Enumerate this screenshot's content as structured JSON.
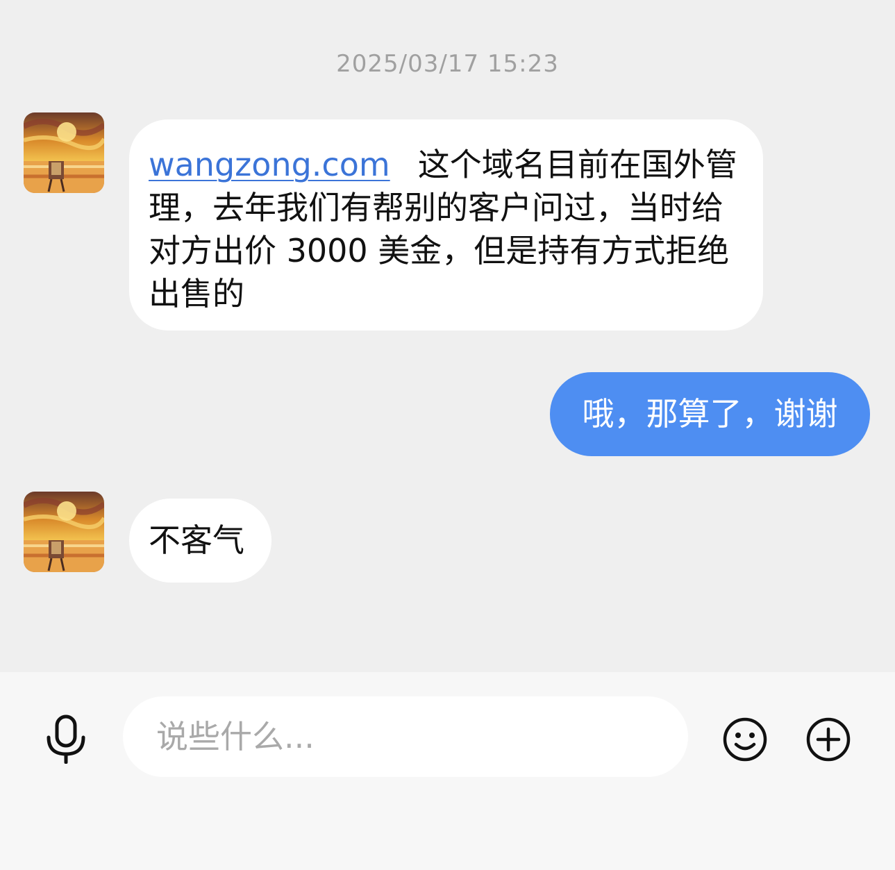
{
  "chat": {
    "timestamp": "2025/03/17 15:23",
    "messages": [
      {
        "sender": "other",
        "link_text": "wangzong.com",
        "text": "这个域名目前在国外管理，去年我们有帮别的客户问过，当时给对方出价 3000 美金，但是持有方式拒绝出售的"
      },
      {
        "sender": "self",
        "text": "哦，那算了，谢谢"
      },
      {
        "sender": "other",
        "text": "不客气"
      }
    ]
  },
  "input_bar": {
    "placeholder": "说些什么...",
    "icons": [
      "microphone-icon",
      "emoji-icon",
      "plus-icon"
    ]
  },
  "colors": {
    "background": "#efefef",
    "self_bubble": "#4e8ef2",
    "other_bubble": "#ffffff",
    "link": "#3b74d8"
  }
}
